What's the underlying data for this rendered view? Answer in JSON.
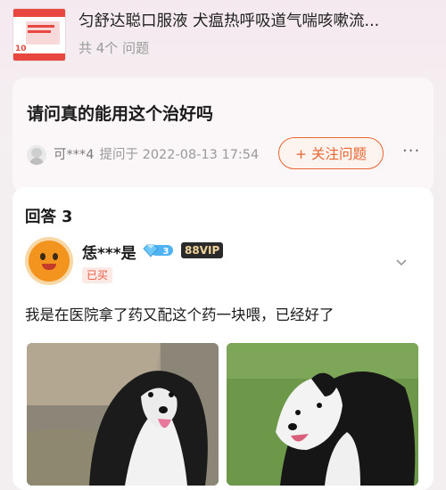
{
  "product": {
    "title": "匀舒达聪口服液 犬瘟热呼吸道气喘咳嗽流...",
    "subtitle": "共 4个 问题",
    "thumb_badge": "10"
  },
  "question": {
    "title": "请问真的能用这个治好吗",
    "asker_name": "可***4",
    "asked_at": "提问于 2022-08-13 17:54",
    "follow_label": "+ 关注问题",
    "more_label": "···"
  },
  "answers": {
    "heading": "回答 3",
    "items": [
      {
        "user": "恁***是",
        "level": "3",
        "vip": "88VIP",
        "bought_tag": "已买",
        "text": "我是在医院拿了药又配这个药一块喂，已经好了"
      }
    ]
  },
  "colors": {
    "accent": "#e8652f",
    "bought": "#e55a43",
    "diamond": "#4fb2f2"
  }
}
